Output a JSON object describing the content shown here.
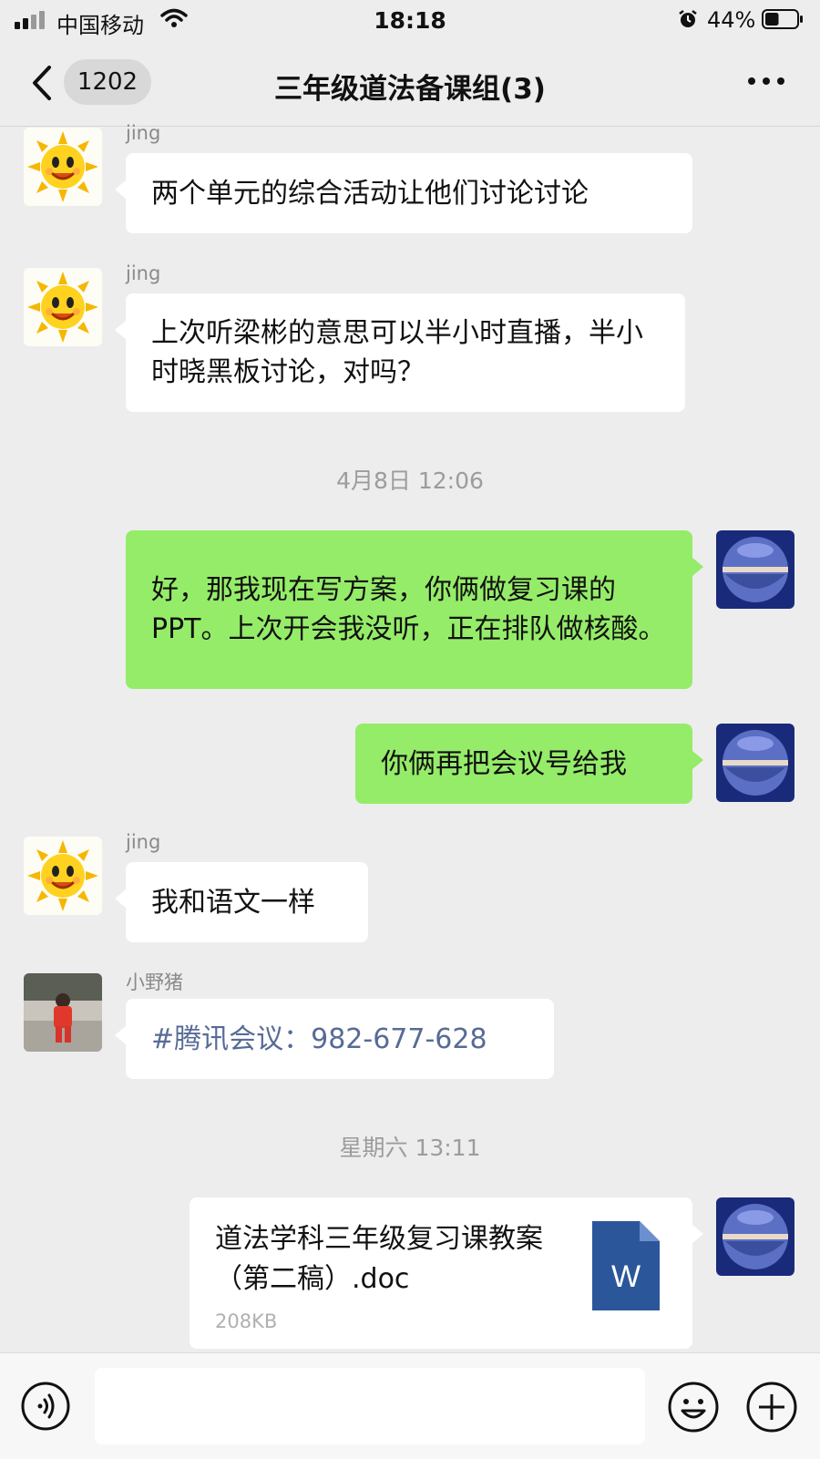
{
  "status_bar": {
    "carrier": "中国移动",
    "time": "18:18",
    "battery_percent": "44%",
    "battery_level": 0.44
  },
  "header": {
    "back_badge": "1202",
    "title": "三年级道法备课组(3)"
  },
  "messages": [
    {
      "sender": "jing",
      "text": "两个单元的综合活动让他们讨论讨论"
    },
    {
      "sender": "jing",
      "text": "上次听梁彬的意思可以半小时直播，半小时晓黑板讨论，对吗？"
    },
    {
      "timestamp": "4月8日 12:06"
    },
    {
      "text": "好，那我现在写方案，你俩做复习课的PPT。上次开会我没听，正在排队做核酸。"
    },
    {
      "text": "你俩再把会议号给我"
    },
    {
      "sender": "jing",
      "text": "我和语文一样"
    },
    {
      "sender": "小野猪",
      "text": "#腾讯会议：982-677-628"
    },
    {
      "timestamp": "星期六 13:11"
    },
    {
      "file": {
        "name": "道法学科三年级复习课教案（第二稿）.doc",
        "size": "208KB",
        "icon_letter": "W"
      }
    }
  ],
  "colors": {
    "outgoing_bubble": "#95ec69",
    "incoming_bubble": "#ffffff",
    "background": "#ededed",
    "link": "#576b95",
    "word_icon": "#2b579a"
  },
  "icons": {
    "back": "chevron-left-icon",
    "more": "more-dots-icon",
    "voice": "voice-icon",
    "emoji": "emoji-icon",
    "plus": "plus-icon",
    "file": "word-doc-icon"
  }
}
